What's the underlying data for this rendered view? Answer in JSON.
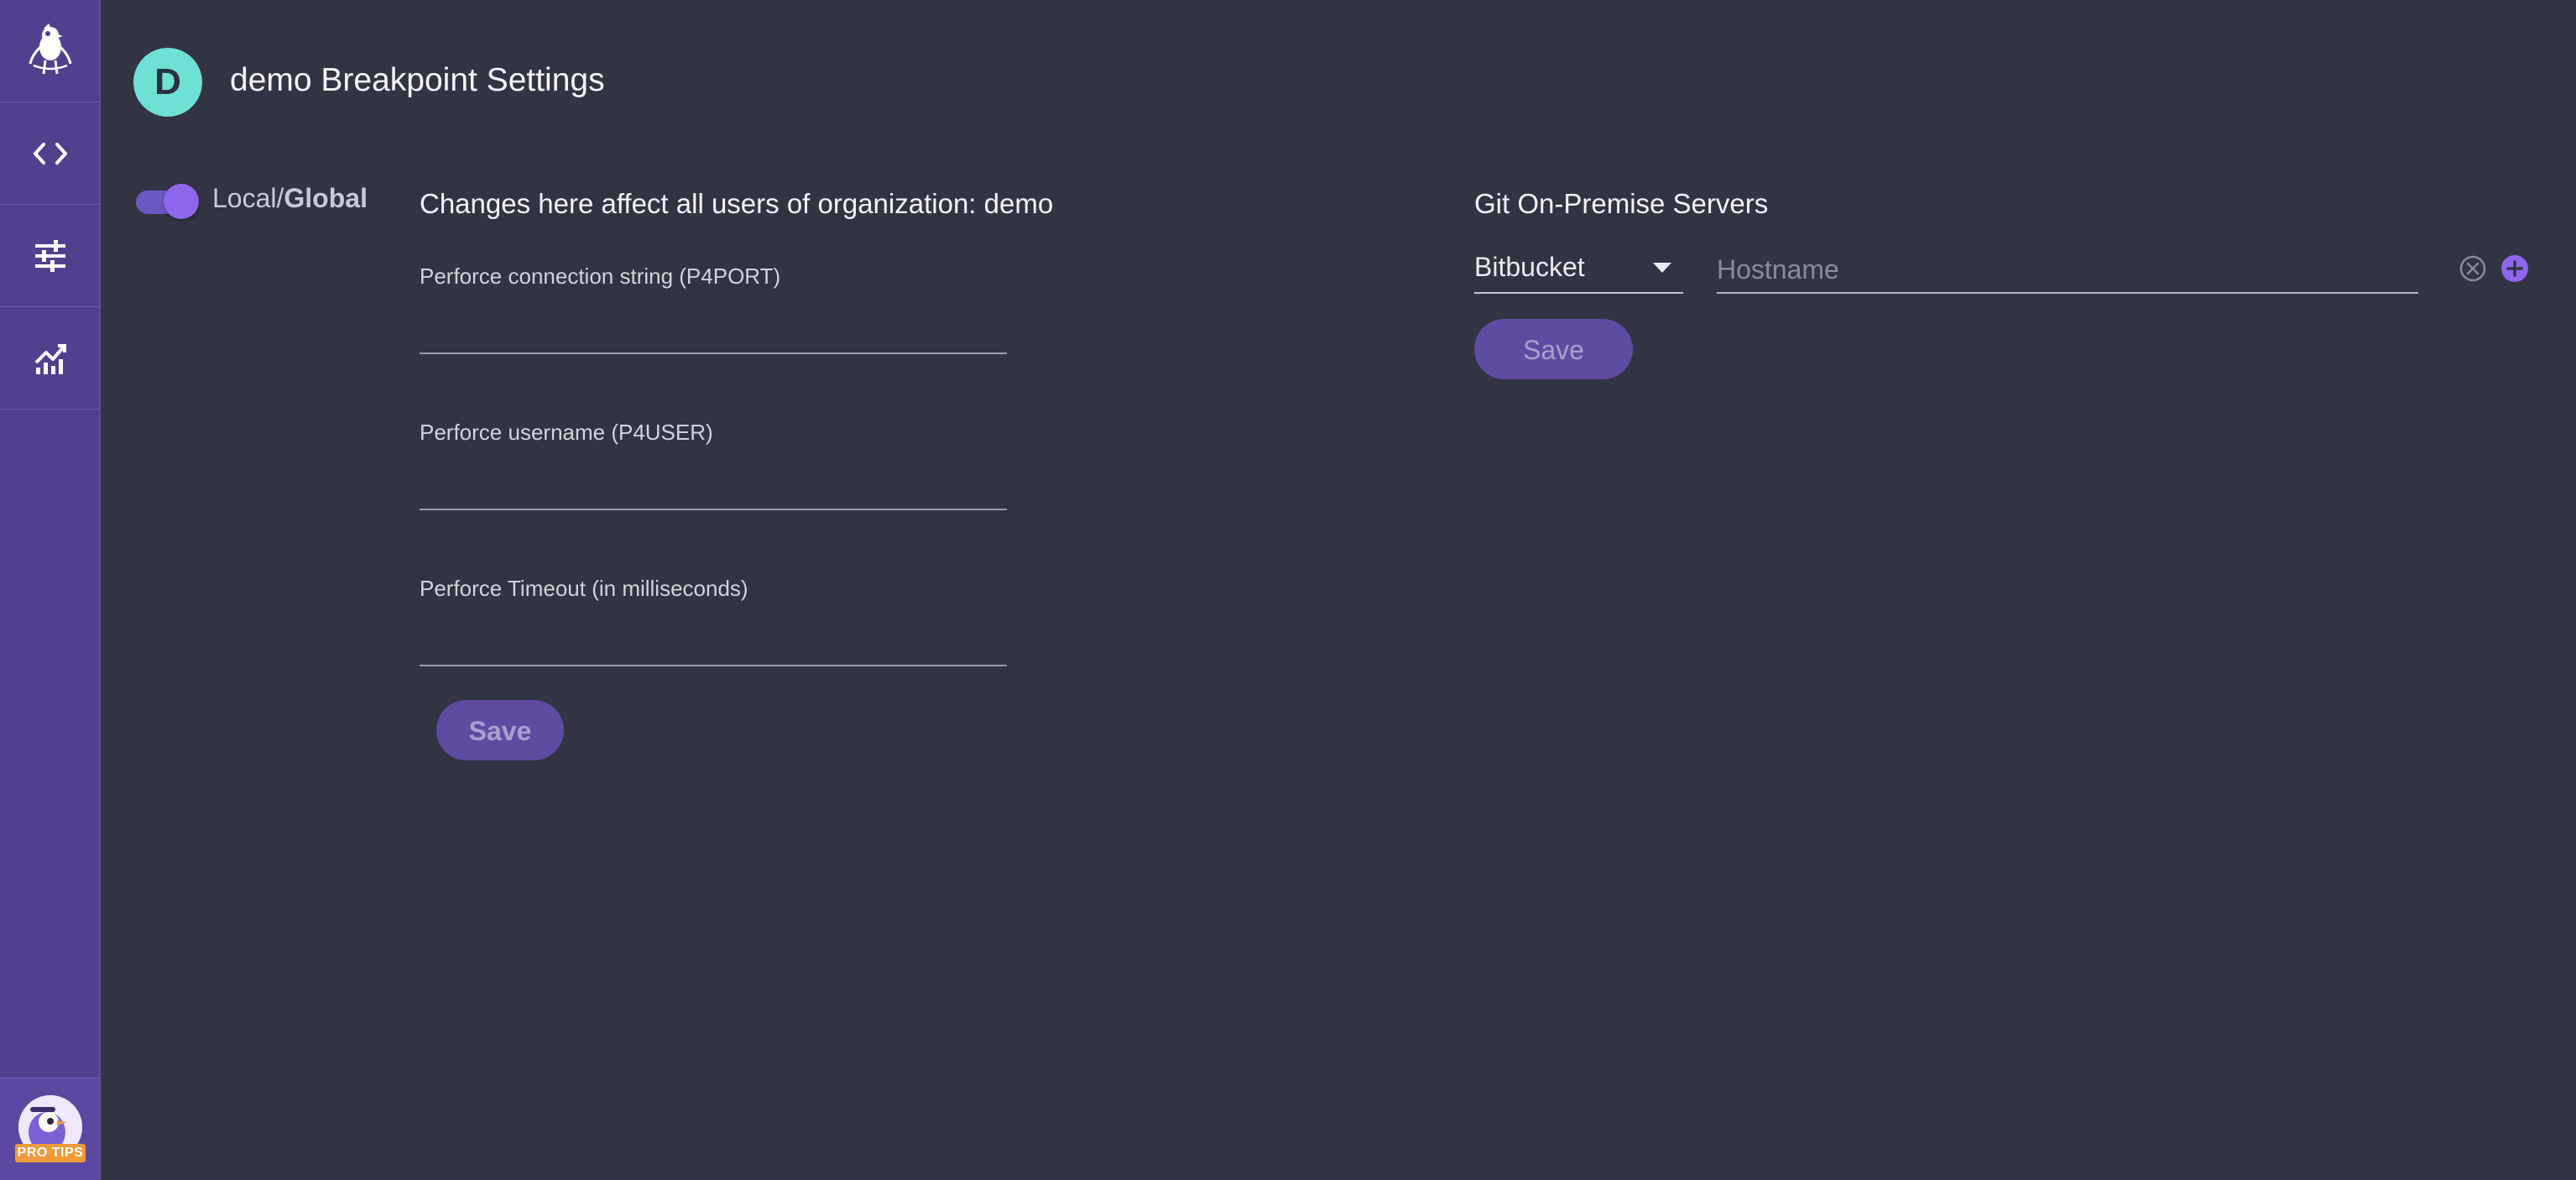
{
  "sidebar": {
    "items": [
      {
        "name": "logo",
        "icon": "bird-logo-icon"
      },
      {
        "name": "code",
        "icon": "code-brackets-icon"
      },
      {
        "name": "settings",
        "icon": "sliders-icon"
      },
      {
        "name": "analytics",
        "icon": "trending-chart-icon"
      }
    ],
    "pro_tips_label": "PRO TIPS"
  },
  "header": {
    "avatar_letter": "D",
    "title": "demo Breakpoint Settings"
  },
  "scope_toggle": {
    "local_label": "Local/",
    "global_label": "Global",
    "state": "global"
  },
  "perforce": {
    "heading": "Changes here affect all users of organization: demo",
    "fields": [
      {
        "label": "Perforce connection string (P4PORT)",
        "value": ""
      },
      {
        "label": "Perforce username (P4USER)",
        "value": ""
      },
      {
        "label": "Perforce Timeout (in milliseconds)",
        "value": ""
      }
    ],
    "save_label": "Save"
  },
  "git_servers": {
    "heading": "Git On-Premise Servers",
    "provider_selected": "Bitbucket",
    "hostname_placeholder": "Hostname",
    "hostname_value": "",
    "save_label": "Save"
  },
  "colors": {
    "background": "#323443",
    "sidebar": "#52408f",
    "accent": "#8f66ee",
    "avatar": "#6fe1d3",
    "button": "#5e4ca3"
  }
}
